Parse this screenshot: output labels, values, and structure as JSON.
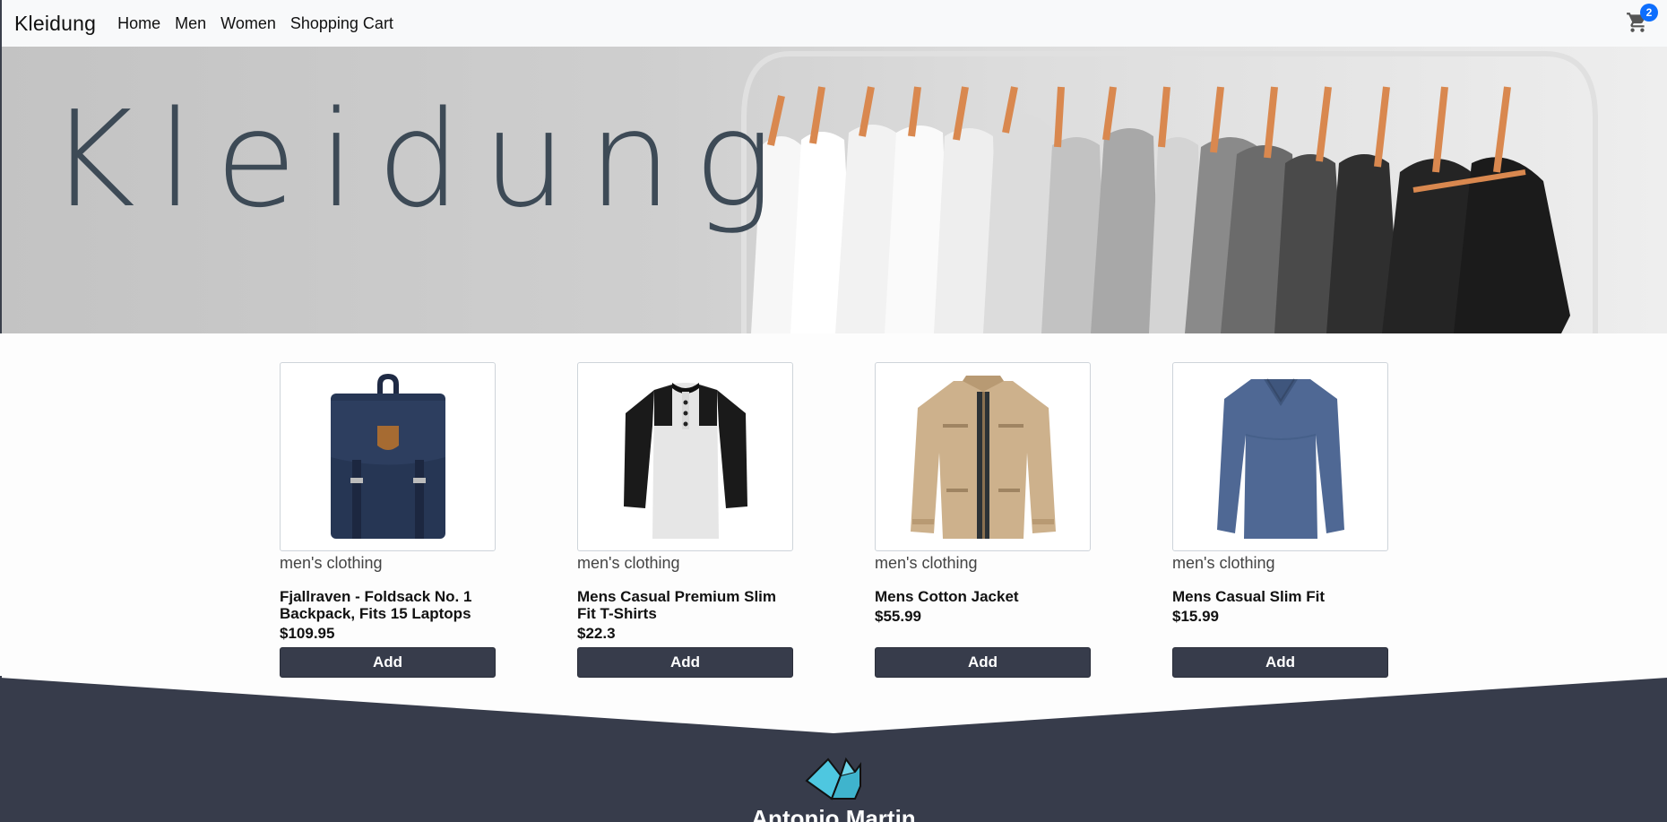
{
  "navbar": {
    "brand": "Kleidung",
    "links": [
      "Home",
      "Men",
      "Women",
      "Shopping Cart"
    ],
    "cart_count": "2"
  },
  "hero": {
    "title": "Kleidung"
  },
  "products": [
    {
      "category": "men's clothing",
      "title": "Fjallraven - Foldsack No. 1 Backpack, Fits 15 Laptops",
      "price": "$109.95",
      "button": "Add"
    },
    {
      "category": "men's clothing",
      "title": "Mens Casual Premium Slim Fit T-Shirts",
      "price": "$22.3",
      "button": "Add"
    },
    {
      "category": "men's clothing",
      "title": "Mens Cotton Jacket",
      "price": "$55.99",
      "button": "Add"
    },
    {
      "category": "men's clothing",
      "title": "Mens Casual Slim Fit",
      "price": "$15.99",
      "button": "Add"
    }
  ],
  "footer": {
    "name": "Antonio Martin"
  },
  "colors": {
    "nav_bg": "#f8f9fa",
    "button_bg": "#373c4b",
    "footer_bg": "#373c4b",
    "badge": "#0d6efd",
    "logo": "#4ec7e0"
  }
}
